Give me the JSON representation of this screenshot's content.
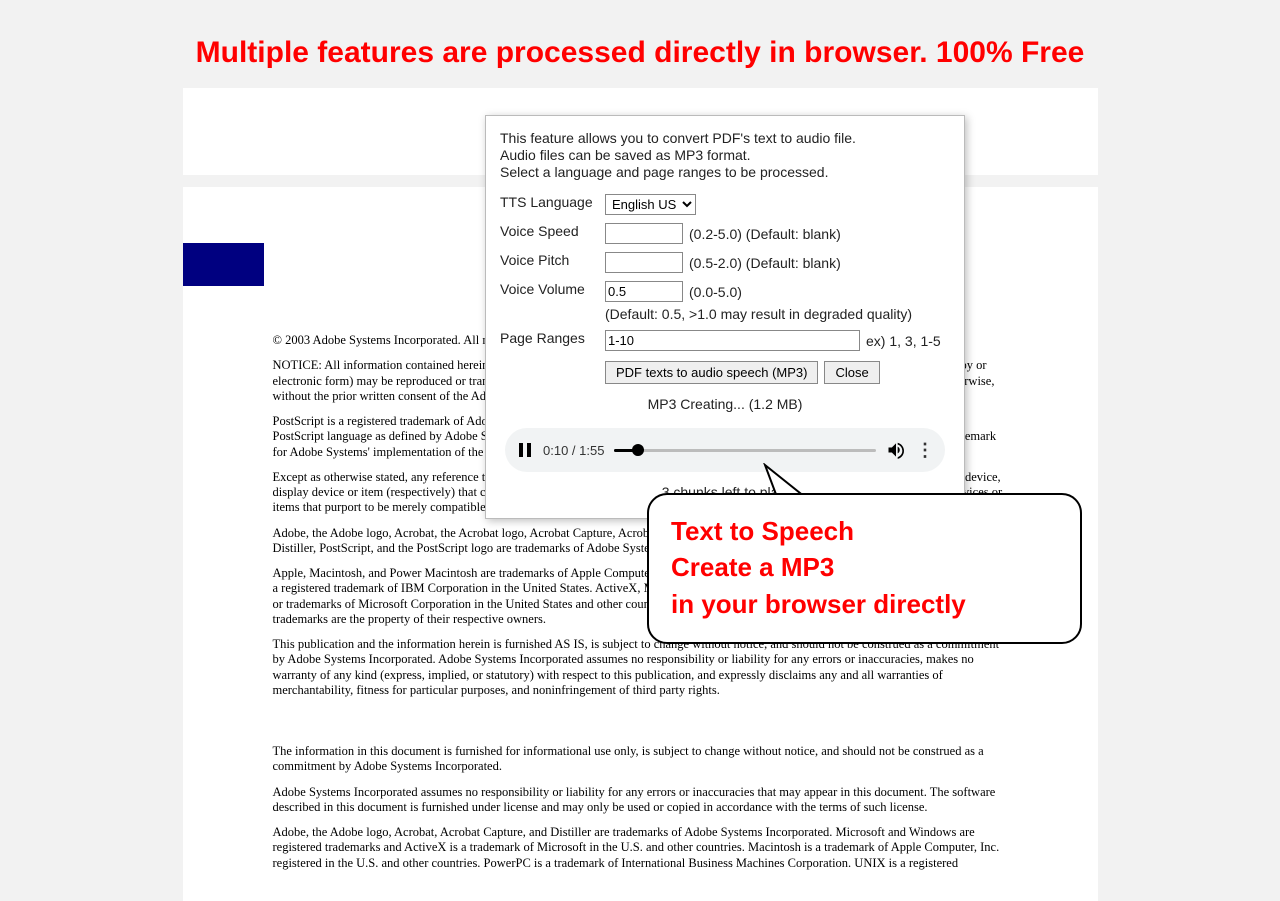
{
  "headline": "Multiple features are processed directly in browser. 100% Free",
  "document": {
    "copyright": "© 2003 Adobe Systems Incorporated. All rights reserved.",
    "p1": "NOTICE: All information contained herein is the property of Adobe Systems Incorporated. No part of this publication (whether in hardcopy or electronic form) may be reproduced or transmitted, in any form or by any means, electronic, mechanical, photocopying, recording, or otherwise, without the prior written consent of the Adobe Systems Incorporated.",
    "p2": "PostScript is a registered trademark of Adobe Systems Incorporated. All instances of the name PostScript in the text are references to the PostScript language as defined by Adobe Systems Incorporated unless otherwise stated. The name PostScript also is used as a product trademark for Adobe Systems' implementation of the PostScript language interpreter.",
    "p3": "Except as otherwise stated, any reference to a \"PostScript printing device,\" \"PostScript display device,\" or similar item refers to a printing device, display device or item (respectively) that contains PostScript technology created or licensed by Adobe Systems Incorporated and not to devices or items that purport to be merely compatible with the PostScript language.",
    "p4": "Adobe, the Adobe logo, Acrobat, the Acrobat logo, Acrobat Capture, Acrobat Catalog, Acrobat Exchange, Acrobat Reader, Acrobat Search, Distiller, PostScript, and the PostScript logo are trademarks of Adobe Systems Incorporated.",
    "p5": "Apple, Macintosh, and Power Macintosh are trademarks of Apple Computer, Inc., registered in the United States and other countries. PowerPC is a registered trademark of IBM Corporation in the United States. ActiveX, Microsoft, Windows, and Windows NT are either registered trademarks or trademarks of Microsoft Corporation in the United States and other countries. UNIX is a registered trademark of The Open Group. All other trademarks are the property of their respective owners.",
    "p6": "This publication and the information herein is furnished AS IS, is subject to change without notice, and should not be construed as a commitment by Adobe Systems Incorporated. Adobe Systems Incorporated assumes no responsibility or liability for any errors or inaccuracies, makes no warranty of any kind (express, implied, or statutory) with respect to this publication, and expressly disclaims any and all warranties of merchantability, fitness for particular purposes, and noninfringement of third party rights.",
    "p7": "The information in this document is furnished for informational use only, is subject to change without notice, and should not be construed as a commitment by Adobe Systems Incorporated.",
    "p8": "Adobe Systems Incorporated assumes no responsibility or liability for any errors or inaccuracies that may appear in this document. The software described in this document is furnished under license and may only be used or copied in accordance with the terms of such license.",
    "p9": "Adobe, the Adobe logo, Acrobat, Acrobat Capture, and Distiller are trademarks of Adobe Systems Incorporated. Microsoft and Windows are registered trademarks and ActiveX is a trademark of Microsoft in the U.S. and other countries. Macintosh is a trademark of Apple Computer, Inc. registered in the U.S. and other countries. PowerPC is a trademark of International Business Machines Corporation. UNIX is a registered"
  },
  "dialog": {
    "intro1": "This feature allows you to convert PDF's text to audio file.",
    "intro2": "Audio files can be saved as MP3 format.",
    "intro3": "Select a language and page ranges to be processed.",
    "labels": {
      "language": "TTS Language",
      "speed": "Voice Speed",
      "pitch": "Voice Pitch",
      "volume": "Voice Volume",
      "page_ranges": "Page Ranges"
    },
    "fields": {
      "language_selected": "English US",
      "speed_value": "",
      "speed_hint": "(0.2-5.0) (Default: blank)",
      "pitch_value": "",
      "pitch_hint": "(0.5-2.0) (Default: blank)",
      "volume_value": "0.5",
      "volume_hint1": "(0.0-5.0)",
      "volume_hint2": "(Default: 0.5, >1.0 may result in degraded quality)",
      "page_ranges_value": "1-10",
      "page_ranges_hint": "ex) 1, 3, 1-5"
    },
    "buttons": {
      "convert": "PDF texts to audio speech (MP3)",
      "close": "Close"
    },
    "status": "MP3 Creating... (1.2 MB)",
    "player": {
      "time": "0:10 / 1:55"
    },
    "chunks": "3 chunks left to play."
  },
  "callout": {
    "line1": "Text to Speech",
    "line2": "Create a MP3",
    "line3": "in your browser directly"
  }
}
